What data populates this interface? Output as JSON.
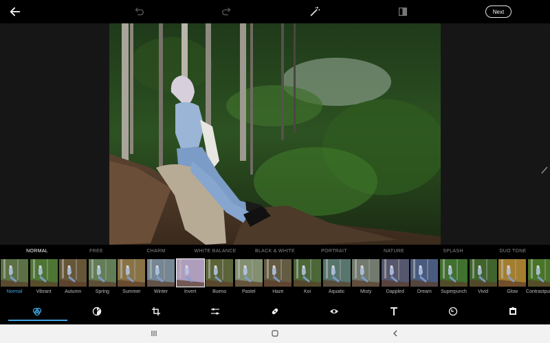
{
  "toolbar_top": {
    "back_icon": "arrow-left-icon",
    "undo_icon": "undo-icon",
    "redo_icon": "redo-icon",
    "auto_fix_icon": "magic-wand-icon",
    "compare_icon": "compare-icon",
    "next_label": "Next"
  },
  "categories": [
    {
      "label": "NORMAL",
      "active": true
    },
    {
      "label": "FREE"
    },
    {
      "label": "CHARM"
    },
    {
      "label": "WHITE BALANCE"
    },
    {
      "label": "BLACK & WHITE"
    },
    {
      "label": "PORTRAIT"
    },
    {
      "label": "NATURE"
    },
    {
      "label": "SPLASH"
    },
    {
      "label": "DUO TONE"
    }
  ],
  "filters": [
    {
      "label": "Normal",
      "tint": "#6f8a55",
      "active": true
    },
    {
      "label": "Vibrant",
      "tint": "#5f8f3f"
    },
    {
      "label": "Autumn",
      "tint": "#7c6a44"
    },
    {
      "label": "Spring",
      "tint": "#79996a"
    },
    {
      "label": "Summer",
      "tint": "#a88d55"
    },
    {
      "label": "Winter",
      "tint": "#8fa5b5"
    },
    {
      "label": "Invert",
      "tint": "#d6c0e8"
    },
    {
      "label": "Bueno",
      "tint": "#6f7a45"
    },
    {
      "label": "Pastel",
      "tint": "#9fb08a"
    },
    {
      "label": "Haze",
      "tint": "#7a6f52"
    },
    {
      "label": "Koi",
      "tint": "#5d7e45"
    },
    {
      "label": "Aquatic",
      "tint": "#6a8f86"
    },
    {
      "label": "Misty",
      "tint": "#8a9586"
    },
    {
      "label": "Dappled",
      "tint": "#6a6a88"
    },
    {
      "label": "Dream",
      "tint": "#5a6f9a"
    },
    {
      "label": "Superpunch",
      "tint": "#4f8a3a"
    },
    {
      "label": "Vivid",
      "tint": "#4d7a38"
    },
    {
      "label": "Glow",
      "tint": "#c99a3a"
    },
    {
      "label": "Contrastpunch",
      "tint": "#5a8f30"
    }
  ],
  "bottom_tools": [
    {
      "name": "looks-icon",
      "active": true
    },
    {
      "name": "adjust-icon"
    },
    {
      "name": "crop-icon"
    },
    {
      "name": "sliders-icon"
    },
    {
      "name": "healing-icon"
    },
    {
      "name": "eye-icon"
    },
    {
      "name": "text-icon"
    },
    {
      "name": "sticker-icon"
    },
    {
      "name": "frame-icon"
    }
  ],
  "colors": {
    "accent": "#41a8e6",
    "background": "#000000"
  }
}
